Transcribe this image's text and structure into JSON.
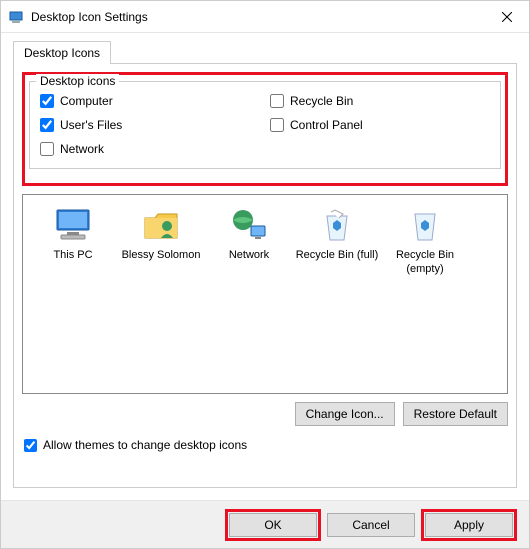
{
  "window": {
    "title": "Desktop Icon Settings"
  },
  "tabs": {
    "active": "Desktop Icons"
  },
  "fieldset": {
    "legend": "Desktop icons",
    "items": [
      {
        "label": "Computer",
        "checked": true
      },
      {
        "label": "Recycle Bin",
        "checked": false
      },
      {
        "label": "User's Files",
        "checked": true
      },
      {
        "label": "Control Panel",
        "checked": false
      },
      {
        "label": "Network",
        "checked": false
      }
    ]
  },
  "preview": {
    "items": [
      {
        "label": "This PC",
        "key": "this-pc"
      },
      {
        "label": "Blessy Solomon",
        "key": "user-folder"
      },
      {
        "label": "Network",
        "key": "network"
      },
      {
        "label": "Recycle Bin (full)",
        "key": "recycle-full"
      },
      {
        "label": "Recycle Bin (empty)",
        "key": "recycle-empty"
      }
    ]
  },
  "buttons": {
    "change_icon": "Change Icon...",
    "restore_default": "Restore Default",
    "ok": "OK",
    "cancel": "Cancel",
    "apply": "Apply"
  },
  "allow_themes": {
    "label": "Allow themes to change desktop icons",
    "checked": true
  }
}
